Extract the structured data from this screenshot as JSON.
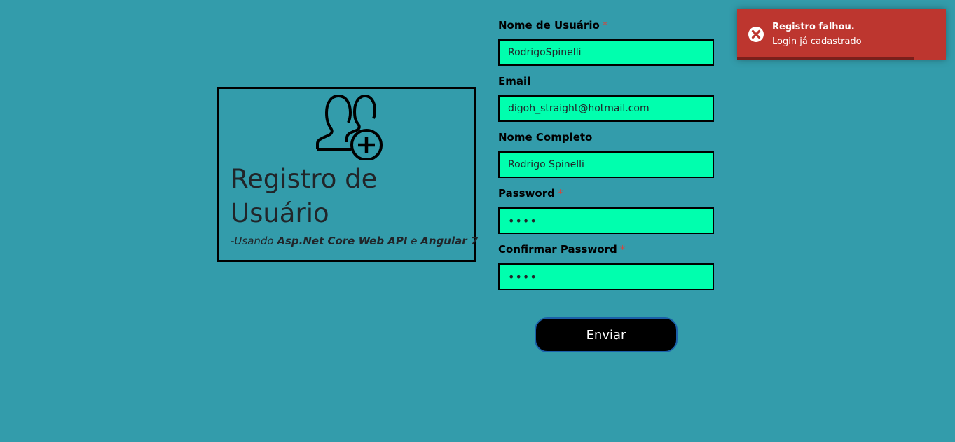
{
  "card": {
    "title": "Registro de Usuário",
    "subtitle_prefix": "-Usando ",
    "subtitle_tech1": "Asp.Net Core Web API",
    "subtitle_middle": " e ",
    "subtitle_tech2": "Angular 7",
    "icon": "add-users-icon"
  },
  "form": {
    "username": {
      "label": "Nome de Usuário",
      "required": "*",
      "value": "RodrigoSpinelli"
    },
    "email": {
      "label": "Email",
      "value": "digoh_straight@hotmail.com"
    },
    "fullname": {
      "label": "Nome Completo",
      "value": "Rodrigo Spinelli"
    },
    "password": {
      "label": "Password",
      "required": "*",
      "value": "1234"
    },
    "confirm_password": {
      "label": "Confirmar Password",
      "required": "*",
      "value": "1234"
    },
    "submit_label": "Enviar"
  },
  "toast": {
    "title": "Registro falhou.",
    "message": "Login já cadastrado",
    "icon": "error-icon",
    "progress": 0.85
  },
  "colors": {
    "background": "#339cab",
    "input_background": "#00ffae",
    "toast_error": "#bd362f"
  }
}
